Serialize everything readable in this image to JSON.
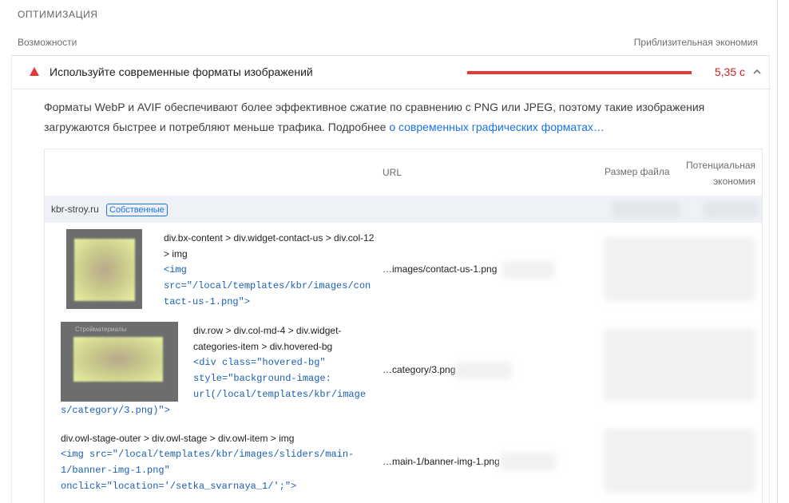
{
  "section": {
    "title": "ОПТИМИЗАЦИЯ",
    "col_left": "Возможности",
    "col_right": "Приблизительная экономия"
  },
  "audit": {
    "title": "Используйте современные форматы изображений",
    "savings": "5,35 с",
    "description_text": "Форматы WebP и AVIF обеспечивают более эффективное сжатие по сравнению с PNG или JPEG, поэтому такие изображения загружаются быстрее и потребляют меньше трафика. Подробнее ",
    "description_link": "о современных графических форматах…",
    "status_color": "#e53935",
    "icon": "fail-triangle-icon"
  },
  "table": {
    "headers": {
      "url": "URL",
      "size": "Размер файла",
      "savings": "Потенциальная экономия"
    },
    "group": {
      "name": "kbr-stroy.ru",
      "badge": "Собственные"
    },
    "rows": [
      {
        "path": "div.bx-content > div.widget-contact-us > div.col-12 > img",
        "snippet": "<img\nsrc=\"/local/templates/kbr/images/con\ntact-us-1.png\">",
        "url": "…images/contact-us-1.png"
      },
      {
        "path": "div.row > div.col-md-4 > div.widget-categories-item > div.hovered-bg",
        "thumb_caption": "Стройматериалы",
        "snippet": "<div class=\"hovered-bg\"\nstyle=\"background-image:\nurl(/local/templates/kbr/image",
        "snippet_tail": "s/category/3.png)\">",
        "url": "…category/3.png"
      },
      {
        "path": "div.owl-stage-outer > div.owl-stage > div.owl-item > img",
        "snippet": "<img src=\"/local/templates/kbr/images/sliders/main-\n1/banner-img-1.png\"\nonclick=\"location='/setka_svarnaya_1/';\">",
        "url": "…main-1/banner-img-1.png"
      }
    ]
  }
}
